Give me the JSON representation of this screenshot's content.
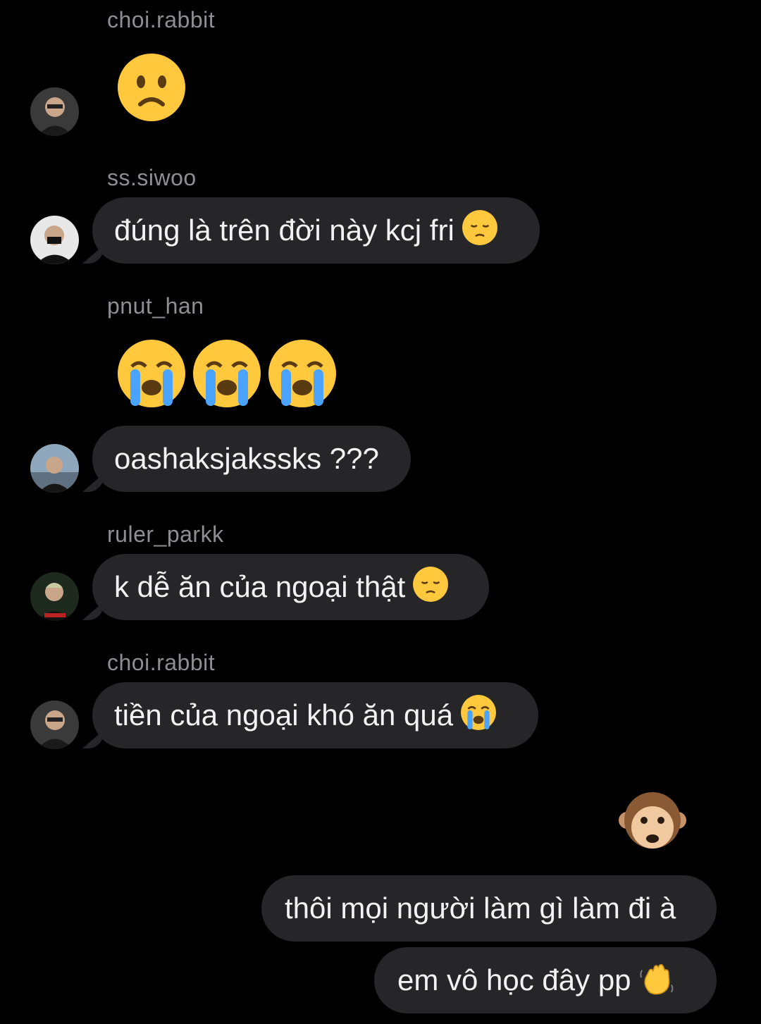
{
  "messages": [
    {
      "sender": "choi.rabbit",
      "emoji": "frowning-face"
    },
    {
      "sender": "ss.siwoo",
      "text": "đúng là trên đời này kcj fri",
      "emoji": "pensive-face"
    },
    {
      "sender": "pnut_han",
      "emoji": "loudly-crying-face x3"
    },
    {
      "text": "oashaksjakssks ???"
    },
    {
      "sender": "ruler_parkk",
      "text": "k dễ ăn của ngoại thật",
      "emoji": "pensive-face"
    },
    {
      "sender": "choi.rabbit",
      "text": "tiền của ngoại khó ăn quá",
      "emoji": "loudly-crying-face"
    }
  ],
  "own_messages": [
    {
      "emoji": "see-no-evil-monkey"
    },
    {
      "text": "thôi mọi người làm gì làm đi à"
    },
    {
      "text": "em vô học đây pp",
      "emoji": "waving-hand"
    }
  ],
  "colors": {
    "background": "#000000",
    "bubble": "#262628",
    "sender_name": "#8e8e93",
    "text": "#f2f2f2"
  }
}
